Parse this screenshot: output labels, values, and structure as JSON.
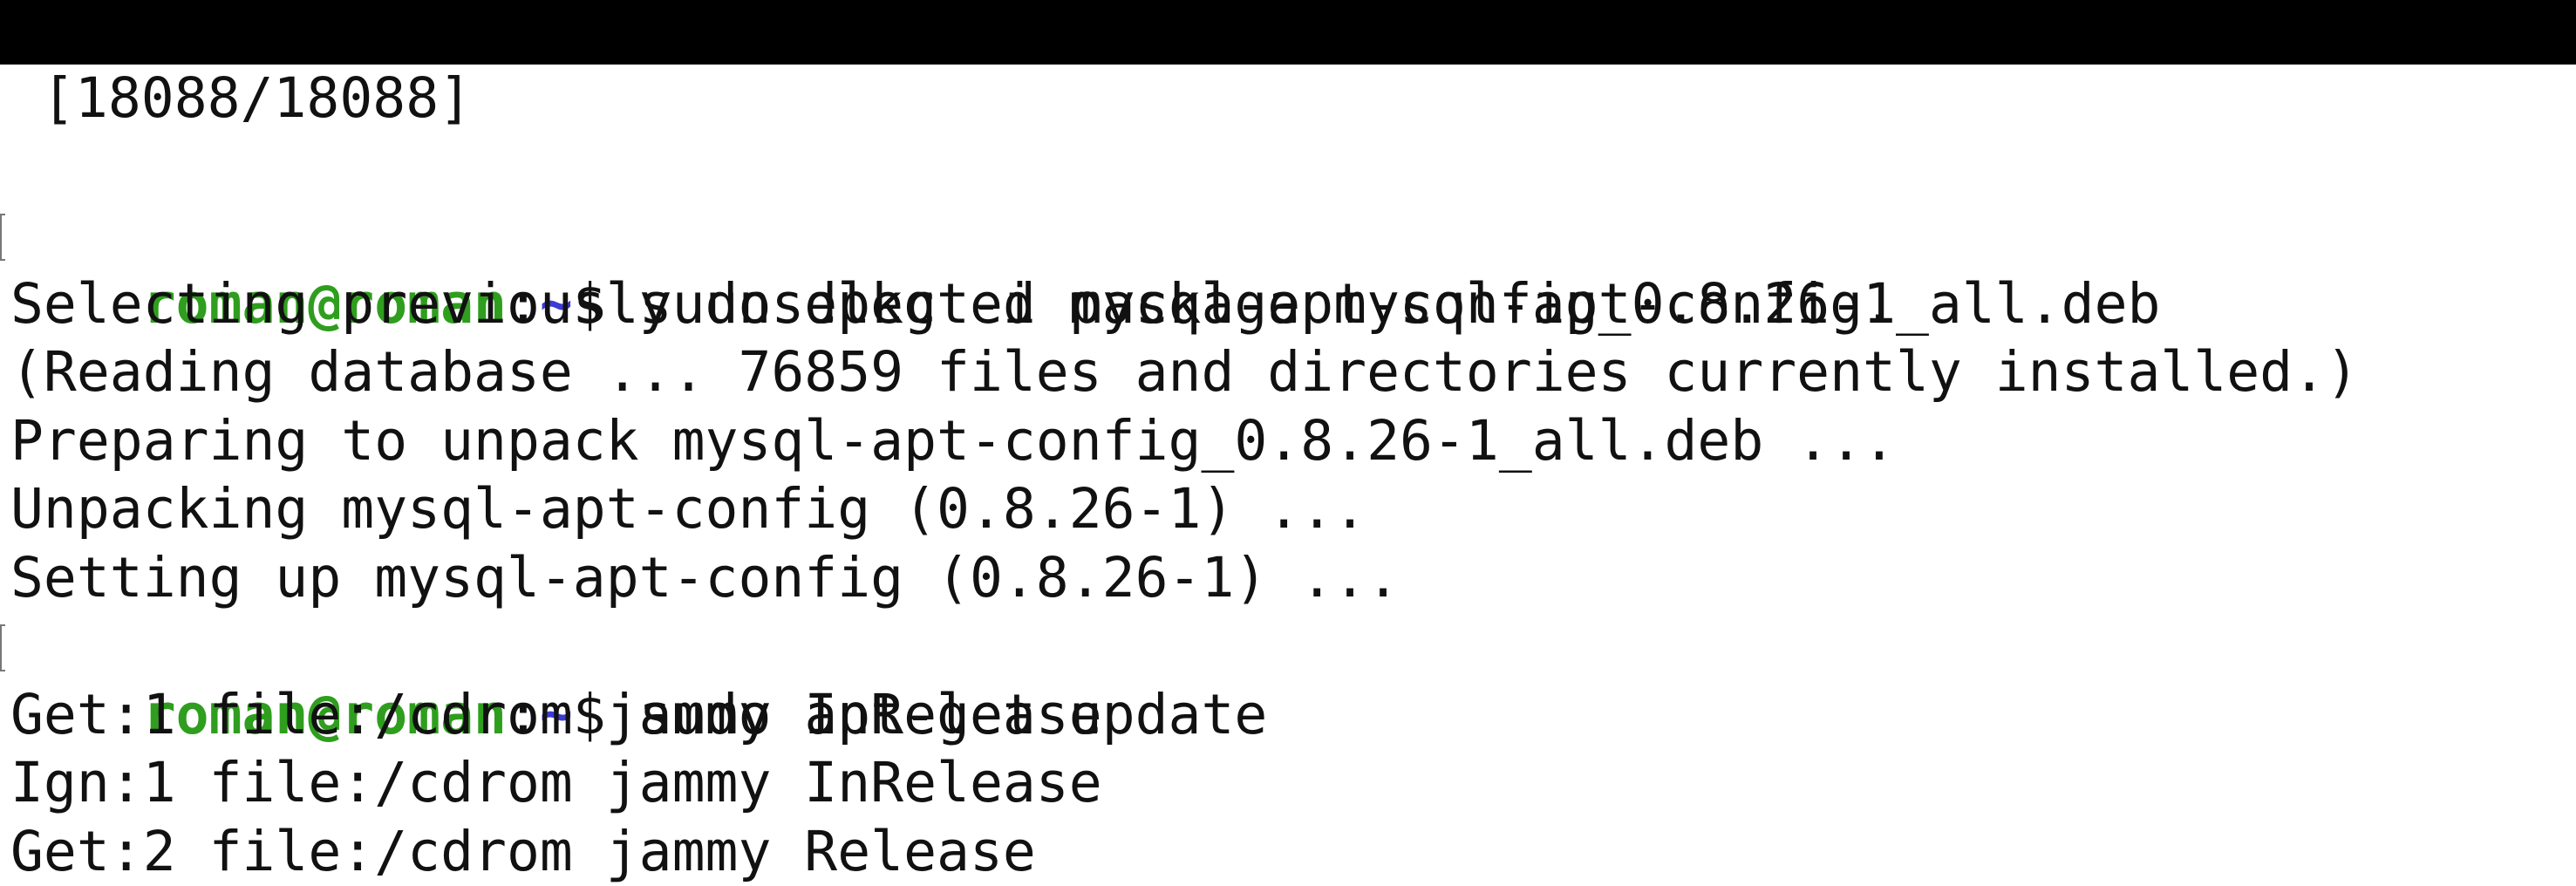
{
  "terminal": {
    "lines": [
      {
        "type": "text",
        "text": "[18088/18088]"
      },
      {
        "type": "blank",
        "text": ""
      },
      {
        "type": "prompt",
        "user": "roman@roman",
        "sep": ":",
        "path": "~",
        "symbol": "$ ",
        "command": "sudo dpkg -i mysql-apt-config_0.8.26-1_all.deb"
      },
      {
        "type": "text",
        "text": "Selecting previously unselected package mysql-apt-config."
      },
      {
        "type": "text",
        "text": "(Reading database ... 76859 files and directories currently installed.)"
      },
      {
        "type": "text",
        "text": "Preparing to unpack mysql-apt-config_0.8.26-1_all.deb ..."
      },
      {
        "type": "text",
        "text": "Unpacking mysql-apt-config (0.8.26-1) ..."
      },
      {
        "type": "text",
        "text": "Setting up mysql-apt-config (0.8.26-1) ..."
      },
      {
        "type": "prompt",
        "user": "roman@roman",
        "sep": ":",
        "path": "~",
        "symbol": "$ ",
        "command": "sudo apt-get update"
      },
      {
        "type": "text",
        "text": "Get:1 file:/cdrom jammy InRelease"
      },
      {
        "type": "text",
        "text": "Ign:1 file:/cdrom jammy InRelease"
      },
      {
        "type": "text",
        "text": "Get:2 file:/cdrom jammy Release"
      }
    ]
  },
  "colors": {
    "titlebar": "#000000",
    "background": "#ffffff",
    "prompt_user": "#2f9e1e",
    "prompt_path": "#3b3bd6",
    "text": "#111111"
  }
}
